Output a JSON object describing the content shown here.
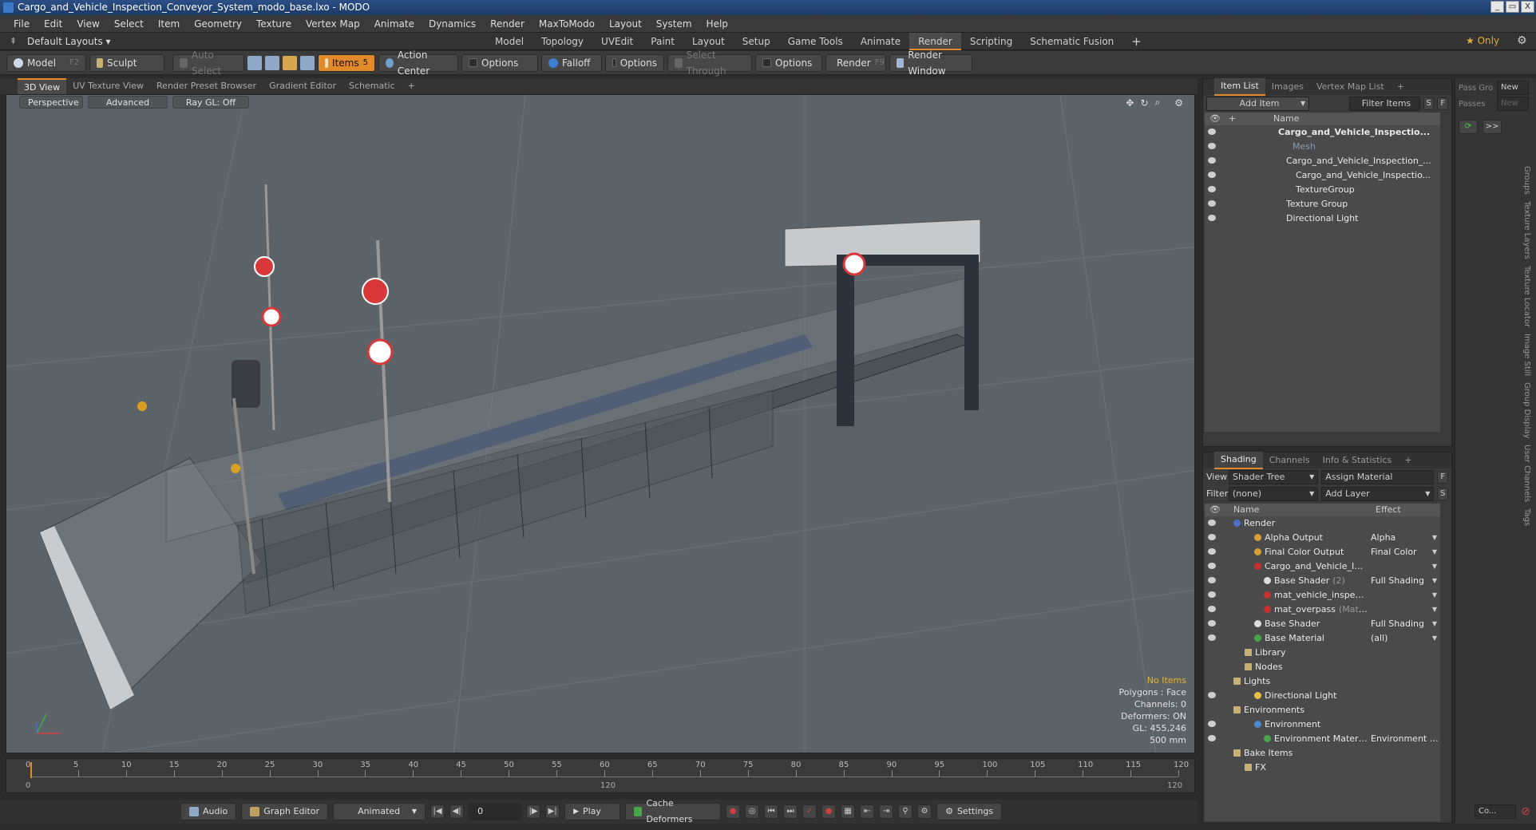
{
  "window": {
    "title": "Cargo_and_Vehicle_Inspection_Conveyor_System_modo_base.lxo - MODO",
    "min": "_",
    "max": "▭",
    "close": "X"
  },
  "menu": [
    "File",
    "Edit",
    "View",
    "Select",
    "Item",
    "Geometry",
    "Texture",
    "Vertex Map",
    "Animate",
    "Dynamics",
    "Render",
    "MaxToModo",
    "Layout",
    "System",
    "Help"
  ],
  "layout_bar": {
    "default_layouts": "Default Layouts ▾",
    "tabs": [
      "Model",
      "Topology",
      "UVEdit",
      "Paint",
      "Layout",
      "Setup",
      "Game Tools",
      "Animate",
      "Render",
      "Scripting",
      "Schematic Fusion"
    ],
    "active_tab": "Render",
    "plus": "+",
    "only": "★ Only"
  },
  "toolbar": {
    "model": "Model",
    "model_key": "F2",
    "sculpt": "Sculpt",
    "auto_select": "Auto Select",
    "items": "Items",
    "items_key": "5",
    "action_center": "Action Center",
    "options1": "Options",
    "falloff": "Falloff",
    "options2": "Options",
    "select_through": "Select Through",
    "options3": "Options",
    "render": "Render",
    "render_key": "F9",
    "render_window": "Render Window"
  },
  "viewport_tabs": [
    "3D View",
    "UV Texture View",
    "Render Preset Browser",
    "Gradient Editor",
    "Schematic"
  ],
  "viewport": {
    "perspective": "Perspective",
    "advanced": "Advanced",
    "ray_gl": "Ray GL: Off",
    "stats": {
      "no_items": "No Items",
      "polygons": "Polygons : Face",
      "channels": "Channels: 0",
      "deformers": "Deformers: ON",
      "gl": "GL: 455,246",
      "size": "500 mm"
    }
  },
  "timeline": {
    "ticks": [
      "0",
      "5",
      "10",
      "15",
      "20",
      "25",
      "30",
      "35",
      "40",
      "45",
      "50",
      "55",
      "60",
      "65",
      "70",
      "75",
      "80",
      "85",
      "90",
      "95",
      "100",
      "105",
      "110",
      "115",
      "120"
    ],
    "start": "0",
    "mid": "120",
    "end": "120"
  },
  "bottom_bar": {
    "audio": "Audio",
    "graph_editor": "Graph Editor",
    "animated": "Animated",
    "frame": "0",
    "play": "Play",
    "cache_deformers": "Cache Deformers",
    "settings": "Settings"
  },
  "item_list": {
    "tabs": [
      "Item List",
      "Images",
      "Vertex Map List"
    ],
    "add_item": "Add Item",
    "filter_items": "Filter Items",
    "s": "S",
    "f": "F",
    "col_name": "Name",
    "rows": [
      {
        "label": "Cargo_and_Vehicle_Inspectio...",
        "indent": 92,
        "bold": true
      },
      {
        "label": "Mesh",
        "indent": 110,
        "dim": true
      },
      {
        "label": "Cargo_and_Vehicle_Inspection_...",
        "indent": 102
      },
      {
        "label": "Cargo_and_Vehicle_Inspectio...",
        "indent": 114
      },
      {
        "label": "TextureGroup",
        "indent": 114
      },
      {
        "label": "Texture Group",
        "indent": 102
      },
      {
        "label": "Directional Light",
        "indent": 102
      }
    ]
  },
  "shading": {
    "tabs": [
      "Shading",
      "Channels",
      "Info & Statistics"
    ],
    "view_label": "View",
    "view_value": "Shader Tree",
    "assign_material": "Assign Material",
    "filter_label": "Filter",
    "filter_value": "(none)",
    "add_layer": "Add Layer",
    "f": "F",
    "s": "S",
    "col_name": "Name",
    "col_effect": "Effect",
    "rows": [
      {
        "label": "Render",
        "effect": "",
        "indent": 36,
        "color": "#4a6fd0"
      },
      {
        "label": "Alpha Output",
        "effect": "Alpha",
        "indent": 62,
        "color": "#d8a030"
      },
      {
        "label": "Final Color Output",
        "effect": "Final Color",
        "indent": 62,
        "color": "#d8a030"
      },
      {
        "label": "Cargo_and_Vehicle_Ins...",
        "effect": "",
        "indent": 62,
        "color": "#c83030"
      },
      {
        "label": "Base Shader",
        "extra": "(2)",
        "effect": "Full Shading",
        "indent": 74,
        "color": "#dddddd"
      },
      {
        "label": "mat_vehicle_inspecti...",
        "effect": "",
        "indent": 74,
        "color": "#c83030"
      },
      {
        "label": "mat_overpass",
        "extra": "(Mate...",
        "effect": "",
        "indent": 74,
        "color": "#c83030"
      },
      {
        "label": "Base Shader",
        "effect": "Full Shading",
        "indent": 62,
        "color": "#dddddd"
      },
      {
        "label": "Base Material",
        "effect": "(all)",
        "indent": 62,
        "color": "#4aa44a"
      },
      {
        "label": "Library",
        "effect": "",
        "indent": 50,
        "color": ""
      },
      {
        "label": "Nodes",
        "effect": "",
        "indent": 50,
        "color": ""
      },
      {
        "label": "Lights",
        "effect": "",
        "indent": 36,
        "color": ""
      },
      {
        "label": "Directional Light",
        "effect": "",
        "indent": 62,
        "color": "#e6c040"
      },
      {
        "label": "Environments",
        "effect": "",
        "indent": 36,
        "color": ""
      },
      {
        "label": "Environment",
        "effect": "",
        "indent": 62,
        "color": "#4a8ad0"
      },
      {
        "label": "Environment Material",
        "effect": "Environment C ...",
        "indent": 74,
        "color": "#4aa44a"
      },
      {
        "label": "Bake Items",
        "effect": "",
        "indent": 36,
        "color": ""
      },
      {
        "label": "FX",
        "effect": "",
        "indent": 50,
        "color": ""
      }
    ]
  },
  "far_right": {
    "pass_group": "Pass Gro",
    "new1": "New",
    "passes": "Passes",
    "new2": "New",
    "bottom_btn": "Co..."
  },
  "side_tabs": [
    "Groups",
    "Texture Layers",
    "Texture Locator",
    "Image Still",
    "Group Display",
    "User Channels",
    "Tags"
  ]
}
